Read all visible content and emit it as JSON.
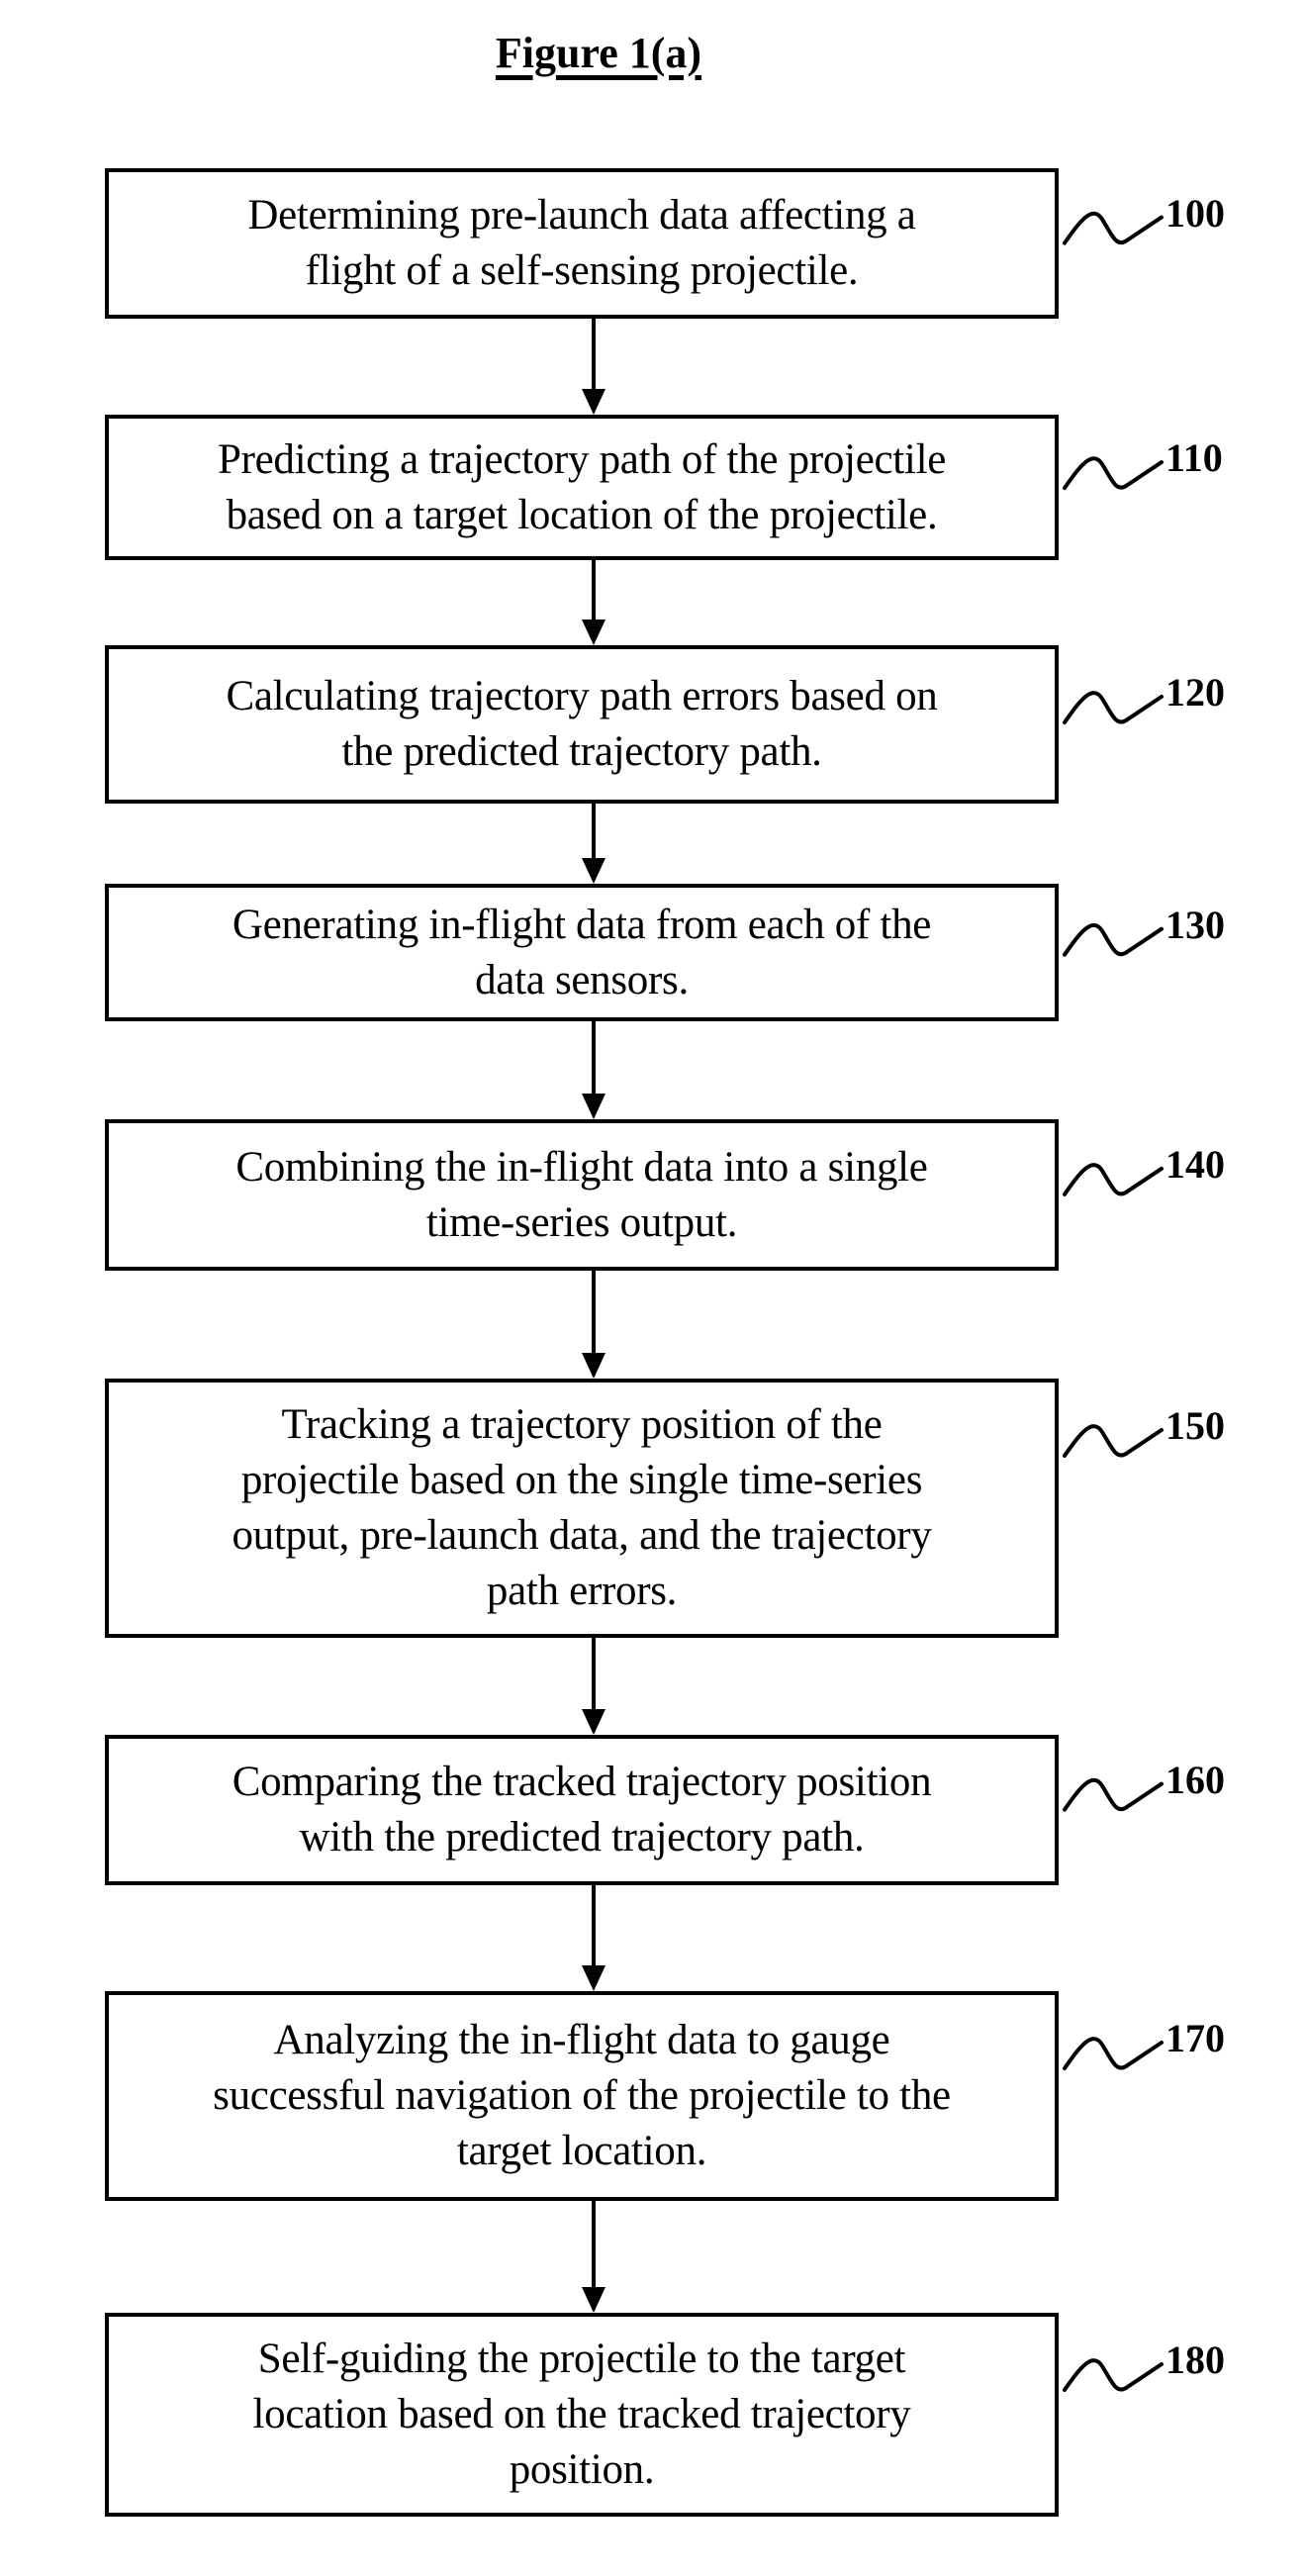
{
  "figure": {
    "title": "Figure 1(a)"
  },
  "steps": [
    {
      "ref": "100",
      "lines": [
        "Determining pre-launch data affecting a",
        "flight of a self-sensing projectile."
      ]
    },
    {
      "ref": "110",
      "lines": [
        "Predicting a trajectory path of the projectile",
        "based on a target location of the projectile."
      ]
    },
    {
      "ref": "120",
      "lines": [
        "Calculating trajectory path errors based on",
        "the predicted trajectory path."
      ]
    },
    {
      "ref": "130",
      "lines": [
        "Generating in-flight data from each of the",
        "data sensors."
      ]
    },
    {
      "ref": "140",
      "lines": [
        "Combining the in-flight data into a single",
        "time-series output."
      ]
    },
    {
      "ref": "150",
      "lines": [
        "Tracking a trajectory position of the",
        "projectile based on the single time-series",
        "output, pre-launch data, and the trajectory",
        "path errors."
      ]
    },
    {
      "ref": "160",
      "lines": [
        "Comparing the tracked trajectory position",
        "with the predicted trajectory path."
      ]
    },
    {
      "ref": "170",
      "lines": [
        "Analyzing the in-flight data to gauge",
        "successful navigation of the projectile to the",
        "target location."
      ]
    },
    {
      "ref": "180",
      "lines": [
        "Self-guiding the projectile to the target",
        "location based on the tracked trajectory",
        "position."
      ]
    }
  ]
}
